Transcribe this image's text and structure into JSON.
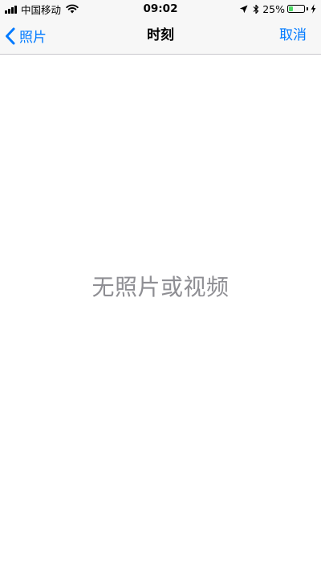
{
  "status_bar": {
    "carrier": "中国移动",
    "time": "09:02",
    "battery_percent": "25%",
    "battery_level": 0.25,
    "battery_color": "#4cd964",
    "icons": [
      "signal-icon",
      "wifi-icon",
      "location-icon",
      "bluetooth-icon",
      "battery-icon",
      "charging-icon"
    ]
  },
  "nav": {
    "back_label": "照片",
    "title": "时刻",
    "cancel_label": "取消",
    "accent_color": "#007aff"
  },
  "main": {
    "empty_message": "无照片或视频"
  }
}
